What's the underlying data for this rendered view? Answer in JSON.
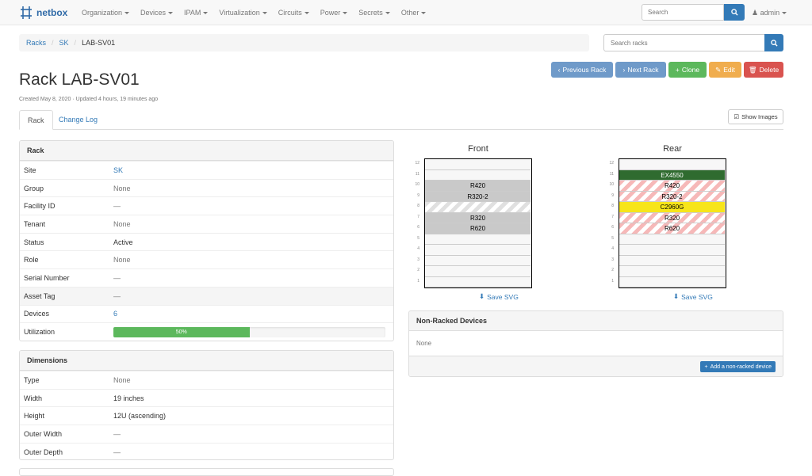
{
  "nav": {
    "brand": "netbox",
    "menu": [
      "Organization",
      "Devices",
      "IPAM",
      "Virtualization",
      "Circuits",
      "Power",
      "Secrets",
      "Other"
    ],
    "search_placeholder": "Search",
    "user": "admin"
  },
  "breadcrumb": [
    "Racks",
    "SK",
    "LAB-SV01"
  ],
  "rack_search_placeholder": "Search racks",
  "actions": {
    "prev": "Previous Rack",
    "next": "Next Rack",
    "clone": "Clone",
    "edit": "Edit",
    "delete": "Delete"
  },
  "title": "Rack LAB-SV01",
  "meta": "Created May 8, 2020 · Updated 4 hours, 19 minutes ago",
  "tabs": [
    "Rack",
    "Change Log"
  ],
  "show_images": "Show Images",
  "rack_panel": {
    "heading": "Rack",
    "rows": [
      {
        "label": "Site",
        "value": "SK"
      },
      {
        "label": "Group",
        "value": "None"
      },
      {
        "label": "Facility ID",
        "value": "—"
      },
      {
        "label": "Tenant",
        "value": "None"
      },
      {
        "label": "Status",
        "value": "Active"
      },
      {
        "label": "Role",
        "value": "None"
      },
      {
        "label": "Serial Number",
        "value": "—"
      },
      {
        "label": "Asset Tag",
        "value": "—"
      },
      {
        "label": "Devices",
        "value": "6"
      },
      {
        "label": "Utilization",
        "value": "50%",
        "fraction": 0.5
      }
    ]
  },
  "dimensions_panel": {
    "heading": "Dimensions",
    "rows": [
      {
        "label": "Type",
        "value": "None"
      },
      {
        "label": "Width",
        "value": "19 inches"
      },
      {
        "label": "Height",
        "value": "12U (ascending)"
      },
      {
        "label": "Outer Width",
        "value": "—"
      },
      {
        "label": "Outer Depth",
        "value": "—"
      }
    ]
  },
  "elevation": {
    "front_title": "Front",
    "rear_title": "Rear",
    "units": [
      "12",
      "11",
      "10",
      "9",
      "8",
      "7",
      "6",
      "5",
      "4",
      "3",
      "2",
      "1"
    ],
    "front": [
      {
        "unit": 10,
        "label": "R420"
      },
      {
        "unit": 9,
        "label": "R320-2"
      },
      {
        "unit": 8,
        "label": ""
      },
      {
        "unit": 7,
        "label": "R320"
      },
      {
        "unit": 6,
        "label": "R620"
      }
    ],
    "rear": [
      {
        "unit": 11,
        "label": "EX4550"
      },
      {
        "unit": 10,
        "label": "R420"
      },
      {
        "unit": 9,
        "label": "R320-2"
      },
      {
        "unit": 8,
        "label": "C2960G"
      },
      {
        "unit": 7,
        "label": "R320"
      },
      {
        "unit": 6,
        "label": "R620"
      }
    ],
    "save_svg": "Save SVG"
  },
  "non_racked": {
    "heading": "Non-Racked Devices",
    "body": "None",
    "add_button": "Add a non-racked device"
  },
  "colors": {
    "primary": "#337ab7",
    "success": "#5cb85c",
    "warning": "#f0ad4e",
    "danger": "#d9534f",
    "ex4550": "#2f6b2f",
    "c2960g": "#f7e51a"
  }
}
